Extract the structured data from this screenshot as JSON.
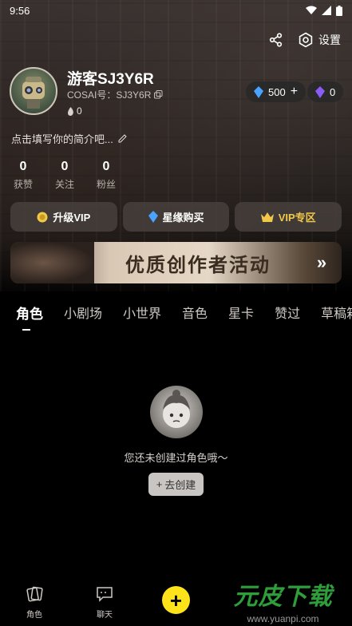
{
  "status": {
    "time": "9:56"
  },
  "header": {
    "settings_label": "设置"
  },
  "profile": {
    "username": "游客SJ3Y6R",
    "cosai_id": "COSAI号：SJ3Y6R",
    "fire_count": "0",
    "bio_placeholder": "点击填写你的简介吧...",
    "stats": [
      {
        "value": "0",
        "label": "获赞"
      },
      {
        "value": "0",
        "label": "关注"
      },
      {
        "value": "0",
        "label": "粉丝"
      }
    ]
  },
  "currency": {
    "blue_gem": "500",
    "purple_gem": "0"
  },
  "actions": {
    "upgrade_vip": "升级VIP",
    "star_purchase": "星缘购买",
    "vip_zone": "VIP专区"
  },
  "banner": {
    "title": "优质创作者活动"
  },
  "tabs": [
    "角色",
    "小剧场",
    "小世界",
    "音色",
    "星卡",
    "赞过",
    "草稿箱"
  ],
  "empty_state": {
    "message": "您还未创建过角色哦～",
    "create_button": "去创建"
  },
  "bottom_nav": {
    "roles": "角色",
    "chat": "聊天"
  },
  "watermark": {
    "title": "元皮下载",
    "url": "www.yuanpi.com"
  },
  "colors": {
    "accent_yellow": "#ffe31a",
    "vip_gold": "#f2c84b",
    "gem_blue": "#4aa3ff",
    "gem_purple": "#8a5cf6"
  }
}
